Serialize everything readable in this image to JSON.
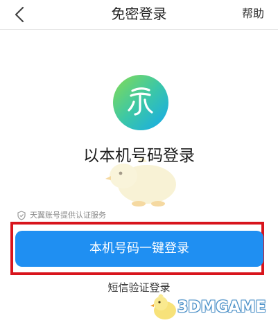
{
  "header": {
    "title": "免密登录",
    "help_label": "帮助"
  },
  "main": {
    "heading": "以本机号码登录",
    "auth_note": "天翼账号提供认证服务",
    "primary_button_label": "本机号码一键登录",
    "sms_login_label": "短信验证登录"
  },
  "watermark": {
    "text": "3DMGAME"
  },
  "colors": {
    "primary": "#1f8ff2",
    "highlight_border": "#d8141c",
    "logo_gradient_start": "#7ed957",
    "logo_gradient_end": "#1bb3e8"
  },
  "icons": {
    "back": "chevron-left-icon",
    "logo": "tianyi-logo-icon",
    "note": "shield-icon"
  }
}
